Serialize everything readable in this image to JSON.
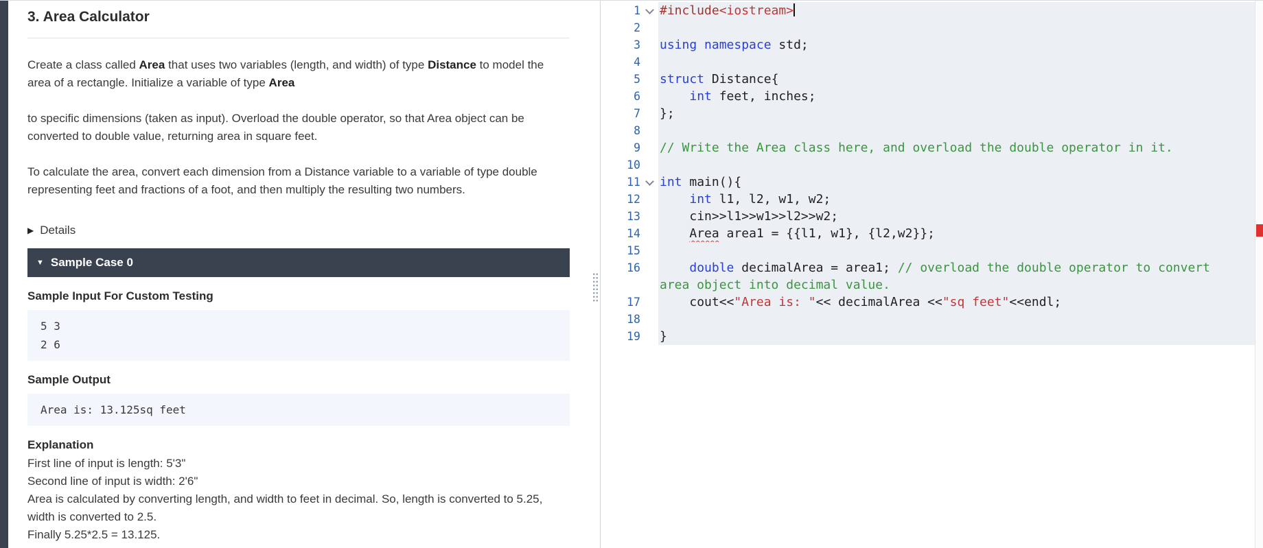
{
  "problem": {
    "title": "3. Area Calculator",
    "paragraphs": [
      [
        {
          "t": "Create a class called "
        },
        {
          "t": "Area",
          "b": true
        },
        {
          "t": " that uses two variables (length, and width) of type "
        },
        {
          "t": "Distance",
          "b": true
        },
        {
          "t": " to model the area of a rectangle. Initialize a variable of type "
        },
        {
          "t": "Area",
          "b": true
        }
      ],
      [
        {
          "t": "to specific dimensions (taken as input). Overload the double operator, so that Area object can be converted to double value, returning area in square feet."
        }
      ],
      [
        {
          "t": "To calculate the area, convert each dimension from a Distance variable to a variable of type double representing feet and fractions of a foot, and then multiply the resulting two numbers."
        }
      ]
    ],
    "details_label": "Details",
    "sample_case": {
      "header": "Sample Case 0",
      "input_label": "Sample Input For Custom Testing",
      "input_lines": [
        "5 3",
        "2 6"
      ],
      "output_label": "Sample Output",
      "output_lines": [
        "Area is: 13.125sq feet"
      ],
      "explanation_label": "Explanation",
      "explanation_lines": [
        "First line of input is length: 5'3\"",
        "Second line of input is width: 2'6\"",
        "Area is calculated by converting length, and width to feet in decimal. So, length is converted to 5.25, width is converted to 2.5.",
        "Finally 5.25*2.5 = 13.125."
      ]
    }
  },
  "editor": {
    "lines": [
      {
        "n": 1,
        "fold": true,
        "cursor": true,
        "segments": [
          {
            "t": "#include",
            "c": "pp"
          },
          {
            "t": "<iostream>",
            "c": "inc"
          }
        ]
      },
      {
        "n": 2,
        "segments": []
      },
      {
        "n": 3,
        "segments": [
          {
            "t": "using",
            "c": "kw"
          },
          {
            "t": " ",
            "c": ""
          },
          {
            "t": "namespace",
            "c": "kw"
          },
          {
            "t": " std;",
            "c": ""
          }
        ]
      },
      {
        "n": 4,
        "segments": []
      },
      {
        "n": 5,
        "segments": [
          {
            "t": "struct",
            "c": "kw"
          },
          {
            "t": " Distance{",
            "c": ""
          }
        ]
      },
      {
        "n": 6,
        "segments": [
          {
            "t": "    ",
            "c": ""
          },
          {
            "t": "int",
            "c": "kw"
          },
          {
            "t": " feet, inches;",
            "c": ""
          }
        ]
      },
      {
        "n": 7,
        "segments": [
          {
            "t": "};",
            "c": ""
          }
        ]
      },
      {
        "n": 8,
        "segments": []
      },
      {
        "n": 9,
        "segments": [
          {
            "t": "// Write the Area class here, and overload the double operator in it.",
            "c": "com"
          }
        ]
      },
      {
        "n": 10,
        "segments": []
      },
      {
        "n": 11,
        "fold": true,
        "segments": [
          {
            "t": "int",
            "c": "kw"
          },
          {
            "t": " main(){",
            "c": ""
          }
        ]
      },
      {
        "n": 12,
        "segments": [
          {
            "t": "    ",
            "c": ""
          },
          {
            "t": "int",
            "c": "kw"
          },
          {
            "t": " l1, l2, w1, w2;",
            "c": ""
          }
        ]
      },
      {
        "n": 13,
        "segments": [
          {
            "t": "    cin>>l1>>w1>>l2>>w2;",
            "c": ""
          }
        ]
      },
      {
        "n": 14,
        "segments": [
          {
            "t": "    ",
            "c": ""
          },
          {
            "t": "Area",
            "c": "err"
          },
          {
            "t": " area1 = {{l1, w1}, {l2,w2}};",
            "c": ""
          }
        ]
      },
      {
        "n": 15,
        "segments": []
      },
      {
        "n": 16,
        "segments": [
          {
            "t": "    ",
            "c": ""
          },
          {
            "t": "double",
            "c": "kw"
          },
          {
            "t": " decimalArea = area1; ",
            "c": ""
          },
          {
            "t": "// overload the double operator to convert",
            "c": "com"
          },
          {
            "br": true
          },
          {
            "t": "area object into decimal value.",
            "c": "com"
          }
        ]
      },
      {
        "n": 17,
        "segments": [
          {
            "t": "    cout<<",
            "c": ""
          },
          {
            "t": "\"Area is: \"",
            "c": "str"
          },
          {
            "t": "<< decimalArea <<",
            "c": ""
          },
          {
            "t": "\"sq feet\"",
            "c": "str"
          },
          {
            "t": "<<endl;",
            "c": ""
          }
        ]
      },
      {
        "n": 18,
        "segments": []
      },
      {
        "n": 19,
        "segments": [
          {
            "t": "}",
            "c": ""
          }
        ]
      }
    ]
  },
  "icons": {
    "details_collapsed": "collapsed-triangle-icon",
    "sample_expanded": "expanded-triangle-icon",
    "fold": "fold-icon",
    "drag_handle": "drag-handle-icon"
  },
  "colors": {
    "header_dark": "#39424e",
    "keyword": "#2940d3",
    "comment": "#3c9440",
    "string": "#c13737",
    "preprocessor": "#a0342f",
    "include_header": "#c13737",
    "line_number": "#2d63ad",
    "code_bg": "#ecf0f5",
    "block_bg": "#f3f6fc",
    "error_red": "#e03131"
  }
}
